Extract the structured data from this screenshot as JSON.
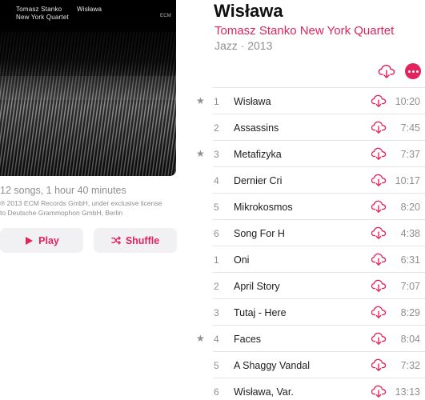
{
  "cover": {
    "artist": "Tomasz Stanko",
    "title": "Wisława",
    "quartet": "New York Quartet",
    "label": "ECM"
  },
  "album": {
    "title": "Wisława",
    "artist": "Tomasz Stanko New York Quartet",
    "genre_year": "Jazz · 2013",
    "meta": "12 songs, 1 hour 40 minutes",
    "copyright_line1": "℗ 2013 ECM Records GmbH, under exclusive license",
    "copyright_line2": "to Deutsche Grammophon GmbH, Berlin"
  },
  "actions": {
    "play_label": "Play",
    "shuffle_label": "Shuffle"
  },
  "colors": {
    "accent": "#e0245e",
    "secondary_text": "#8e8e93",
    "button_bg": "#f1f1f3"
  },
  "icons": {
    "download": "cloud-download-icon",
    "more": "more-ellipsis-icon",
    "play": "play-icon",
    "shuffle": "shuffle-icon",
    "favorite": "star-icon"
  },
  "tracks": [
    {
      "star": "★",
      "num": "1",
      "name": "Wisława",
      "duration": "10:20"
    },
    {
      "star": "",
      "num": "2",
      "name": "Assassins",
      "duration": "7:45"
    },
    {
      "star": "★",
      "num": "3",
      "name": "Metafizyka",
      "duration": "7:37"
    },
    {
      "star": "",
      "num": "4",
      "name": "Dernier Cri",
      "duration": "10:17"
    },
    {
      "star": "",
      "num": "5",
      "name": "Mikrokosmos",
      "duration": "8:20"
    },
    {
      "star": "",
      "num": "6",
      "name": "Song For H",
      "duration": "4:38"
    },
    {
      "star": "",
      "num": "1",
      "name": "Oni",
      "duration": "6:31"
    },
    {
      "star": "",
      "num": "2",
      "name": "April Story",
      "duration": "7:07"
    },
    {
      "star": "",
      "num": "3",
      "name": "Tutaj - Here",
      "duration": "8:29"
    },
    {
      "star": "★",
      "num": "4",
      "name": "Faces",
      "duration": "8:04"
    },
    {
      "star": "",
      "num": "5",
      "name": "A Shaggy Vandal",
      "duration": "7:32"
    },
    {
      "star": "",
      "num": "6",
      "name": "Wisława, Var.",
      "duration": "13:13"
    }
  ]
}
